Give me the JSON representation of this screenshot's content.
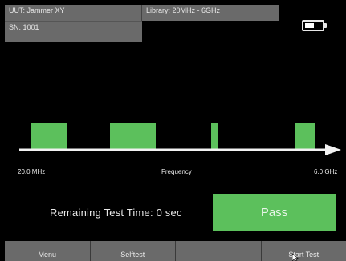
{
  "header": {
    "uut_text": "UUT: Jammer XY",
    "sn_text": "SN: 1001",
    "library_text": "Library: 20MHz - 6GHz"
  },
  "battery": {
    "level": 0.55,
    "icon": "battery-icon"
  },
  "spectrum": {
    "min_label": "20.0 MHz",
    "axis_title": "Frequency",
    "max_label": "6.0 GHz",
    "bar_color": "#5cc05c"
  },
  "status": {
    "remaining_text": "Remaining Test Time: 0 sec",
    "result_label": "Pass",
    "result_color": "#5cc05c"
  },
  "softkeys": [
    "Menu",
    "Selftest",
    "",
    "Start Test"
  ]
}
